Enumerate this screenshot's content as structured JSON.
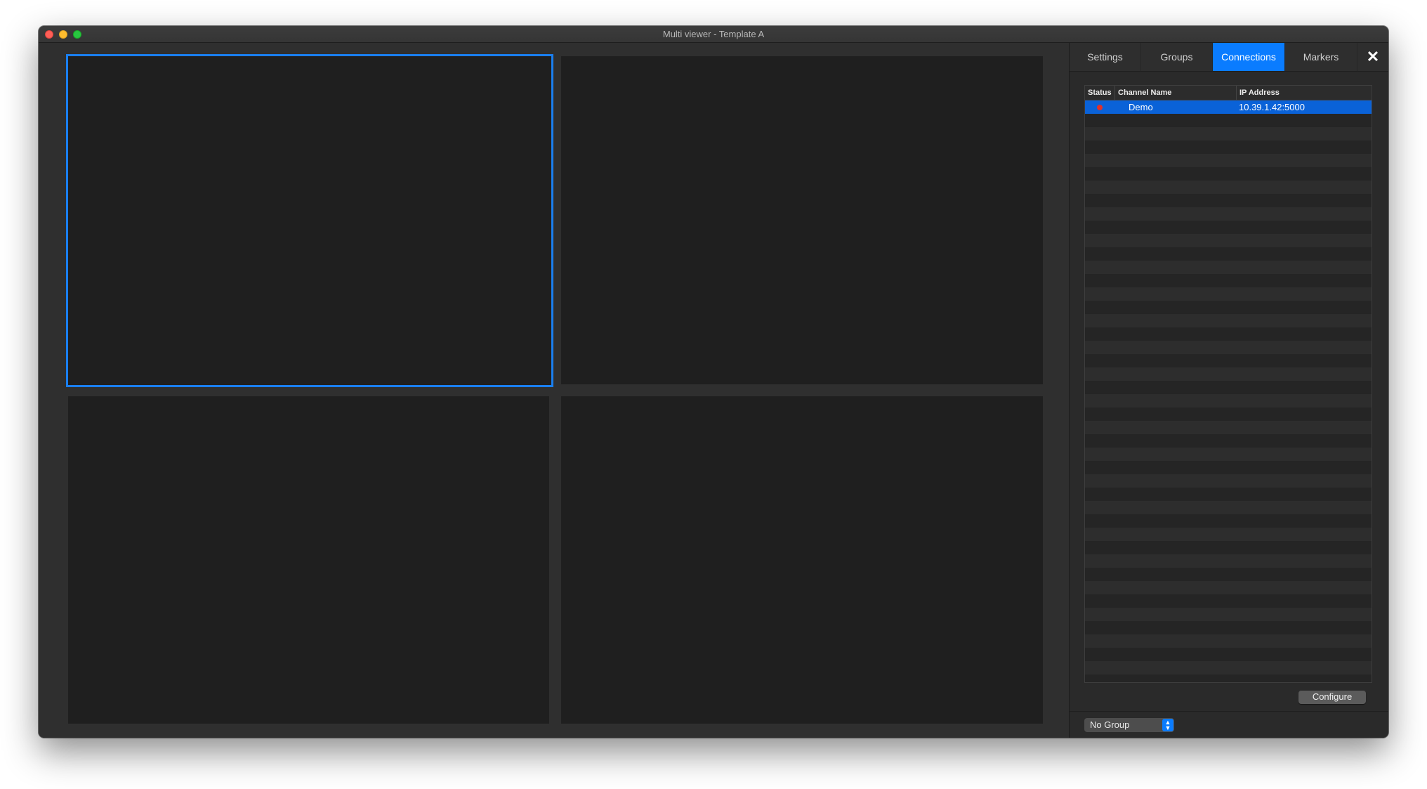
{
  "window": {
    "title": "Multi viewer - Template A"
  },
  "tabs": [
    {
      "label": "Settings",
      "active": false
    },
    {
      "label": "Groups",
      "active": false
    },
    {
      "label": "Connections",
      "active": true
    },
    {
      "label": "Markers",
      "active": false
    }
  ],
  "close_icon": "close-icon",
  "table": {
    "headers": {
      "status": "Status",
      "channel": "Channel Name",
      "ip": "IP Address"
    },
    "rows": [
      {
        "status_color": "#e0312a",
        "channel": "Demo",
        "ip": "10.39.1.42:5000",
        "selected": true
      }
    ]
  },
  "configure_label": "Configure",
  "group_select": {
    "value": "No Group"
  },
  "colors": {
    "accent": "#0a7cff",
    "selection_border": "#1a7ff0",
    "status_offline": "#e0312a"
  }
}
